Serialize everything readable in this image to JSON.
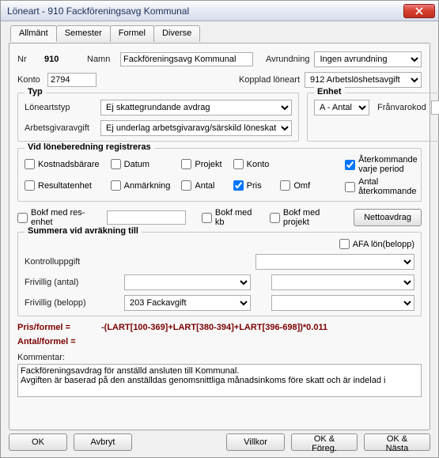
{
  "titlebar": {
    "title": "Löneart - 910  Fackföreningsavg Kommunal"
  },
  "tabs": {
    "allmant": "Allmänt",
    "semester": "Semester",
    "formel": "Formel",
    "diverse": "Diverse"
  },
  "header": {
    "nr_label": "Nr",
    "nr_value": "910",
    "name_label": "Namn",
    "name_value": "Fackföreningsavg Kommunal",
    "avrund_label": "Avrundning",
    "avrund_value": "Ingen avrundning",
    "konto_label": "Konto",
    "konto_value": "2794",
    "kopplad_label": "Kopplad löneart",
    "kopplad_value": "912 Arbetslöshetsavgift"
  },
  "typ": {
    "legend": "Typ",
    "loneartstyp_label": "Löneartstyp",
    "loneartstyp_value": "Ej skattegrundande avdrag",
    "arbgiv_label": "Arbetsgivaravgift",
    "arbgiv_value": "Ej underlag arbetsgivaravg/särskild löneskat"
  },
  "enhet": {
    "legend": "Enhet",
    "value": "A - Antal",
    "franvaro_label": "Frånvarokod",
    "franvaro_value": ""
  },
  "reg": {
    "legend": "Vid löneberedning registreras",
    "kostnadsbarare": "Kostnadsbärare",
    "datum": "Datum",
    "projekt": "Projekt",
    "konto": "Konto",
    "aterkommande": "Återkommande varje period",
    "resultatenhet": "Resultatenhet",
    "anmarkning": "Anmärkning",
    "antal": "Antal",
    "pris": "Pris",
    "omf": "Omf",
    "antal_ater": "Antal återkommande"
  },
  "bokf": {
    "resenhet": "Bokf med res-enhet",
    "kb": "Bokf med kb",
    "projekt": "Bokf med projekt",
    "netto_btn": "Nettoavdrag"
  },
  "summera": {
    "legend": "Summera vid avräkning till",
    "afa": "AFA lön(belopp)",
    "kontrolluppgift": "Kontrolluppgift",
    "friv_antal": "Frivillig (antal)",
    "friv_belopp": "Frivillig (belopp)",
    "friv_belopp_value": "203 Fackavgift"
  },
  "formel_sec": {
    "pris_label": "Pris/formel =",
    "pris_value": "-(LART[100-369]+LART[380-394]+LART[396-698])*0.011",
    "antal_label": "Antal/formel ="
  },
  "comment": {
    "label": "Kommentar:",
    "text": "Fackföreningsavdrag för anställd ansluten till Kommunal.\nAvgiften är baserad på den anställdas genomsnittliga månadsinkoms före skatt och är indelad i"
  },
  "buttons": {
    "ok": "OK",
    "avbryt": "Avbryt",
    "villkor": "Villkor",
    "ok_foreg": "OK & Föreg.",
    "ok_nasta": "OK & Nästa"
  }
}
